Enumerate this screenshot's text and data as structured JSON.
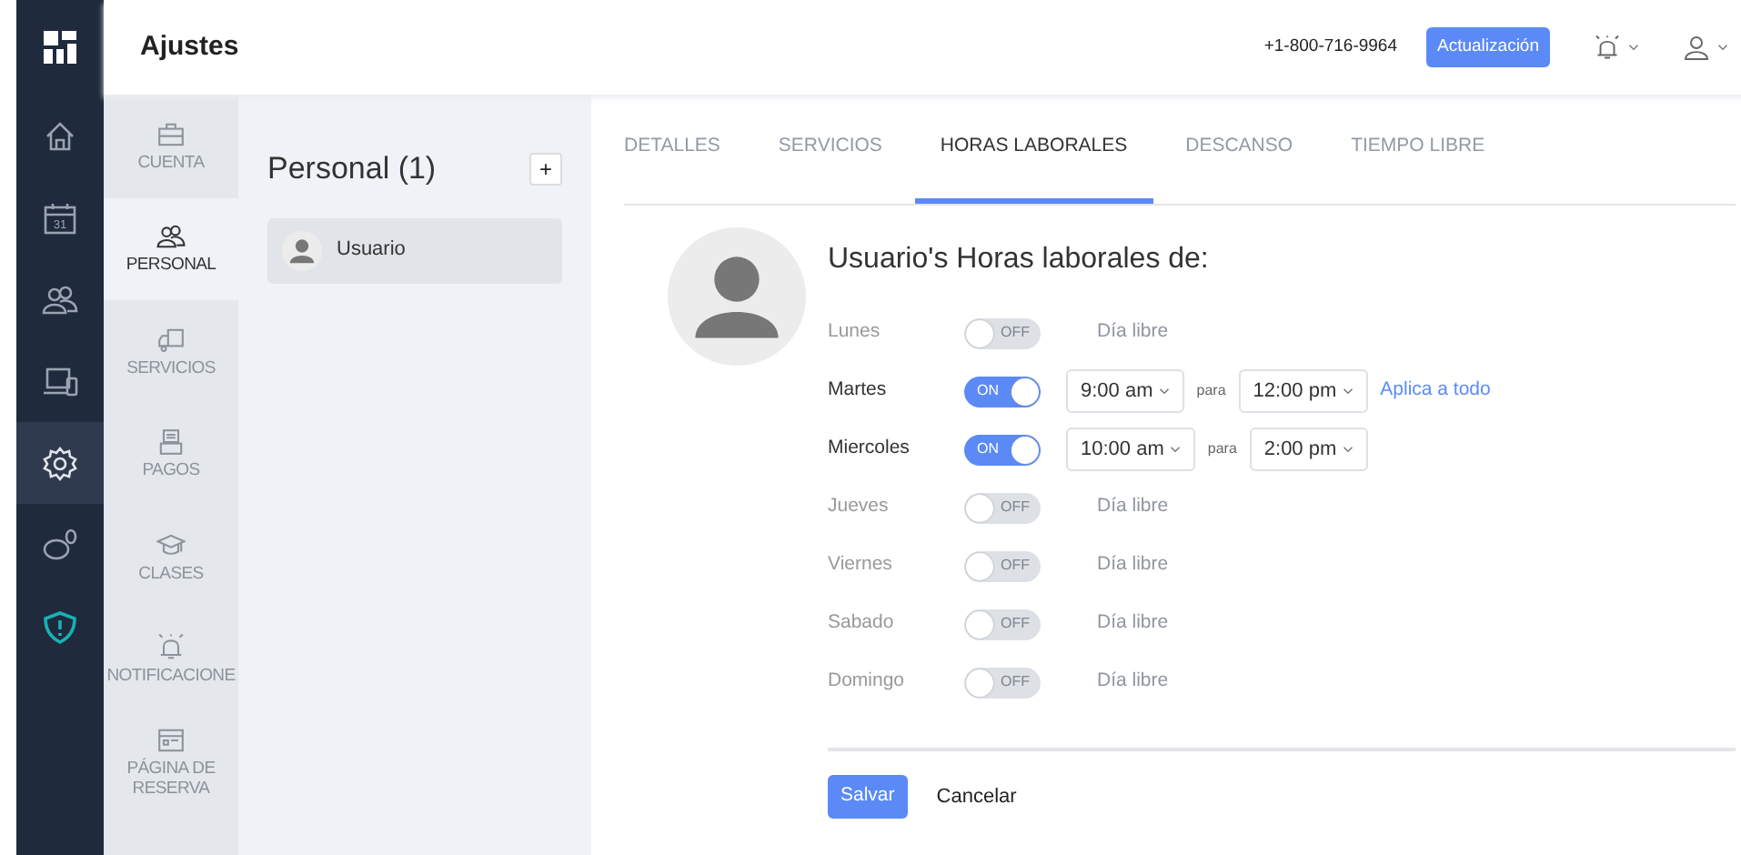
{
  "header": {
    "title": "Ajustes",
    "phone": "+1-800-716-9964",
    "upgrade_button": "Actualización"
  },
  "rail": [
    {
      "selected": false
    },
    {
      "selected": false,
      "text": "31"
    },
    {
      "selected": false
    },
    {
      "selected": false
    },
    {
      "selected": true
    },
    {
      "selected": false
    },
    {
      "selected": false
    }
  ],
  "settings_nav": [
    {
      "label": "CUENTA",
      "selected": false
    },
    {
      "label": "PERSONAL",
      "selected": true
    },
    {
      "label": "SERVICIOS",
      "selected": false
    },
    {
      "label": "PAGOS",
      "selected": false
    },
    {
      "label": "CLASES",
      "selected": false
    },
    {
      "label": "NOTIFICACIONE",
      "selected": false
    },
    {
      "label": "PÁGINA DE RESERVA",
      "selected": false
    }
  ],
  "staff": {
    "title": "Personal (1)",
    "add_button": "+",
    "items": [
      {
        "name": "Usuario",
        "selected": true
      }
    ]
  },
  "tabs": [
    {
      "label": "DETALLES",
      "selected": false
    },
    {
      "label": "SERVICIOS",
      "selected": false
    },
    {
      "label": "HORAS LABORALES",
      "selected": true
    },
    {
      "label": "DESCANSO",
      "selected": false
    },
    {
      "label": "TIEMPO LIBRE",
      "selected": false
    }
  ],
  "schedule": {
    "title": "Usuario's Horas laborales de:",
    "days": [
      {
        "day": "Lunes",
        "on": false,
        "toggle": "OFF",
        "note": "Día libre"
      },
      {
        "day": "Martes",
        "on": true,
        "toggle": "ON",
        "start": "9:00 am",
        "joiner": "para",
        "end": "12:00 pm",
        "link": "Aplica a todo"
      },
      {
        "day": "Miercoles",
        "on": true,
        "toggle": "ON",
        "start": "10:00 am",
        "joiner": "para",
        "end": "2:00 pm"
      },
      {
        "day": "Jueves",
        "on": false,
        "toggle": "OFF",
        "note": "Día libre"
      },
      {
        "day": "Viernes",
        "on": false,
        "toggle": "OFF",
        "note": "Día libre"
      },
      {
        "day": "Sabado",
        "on": false,
        "toggle": "OFF",
        "note": "Día libre"
      },
      {
        "day": "Domingo",
        "on": false,
        "toggle": "OFF",
        "note": "Día libre"
      }
    ],
    "save_button": "Salvar",
    "cancel_button": "Cancelar"
  }
}
